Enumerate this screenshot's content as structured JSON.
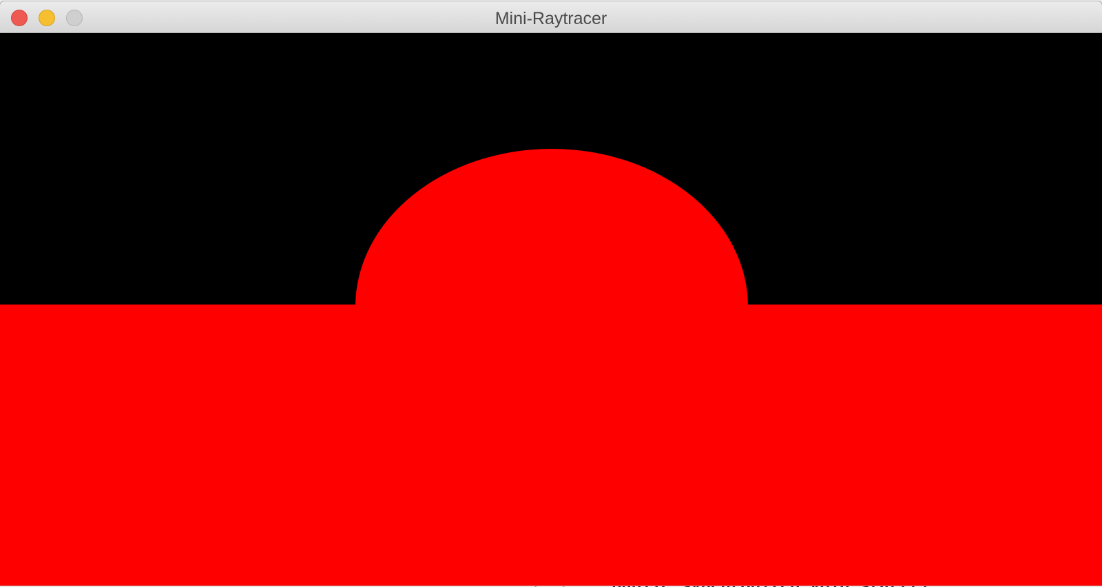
{
  "window": {
    "title": "Mini-Raytracer",
    "controls": {
      "close": "close-icon",
      "minimize": "minimize-icon",
      "zoom": "zoom-icon"
    }
  },
  "render": {
    "background_color": "#000000",
    "plane_color": "#ff0000",
    "sphere_color": "#ff0000"
  },
  "background_editor": {
    "code_fragment": "public synchronized void start()"
  }
}
